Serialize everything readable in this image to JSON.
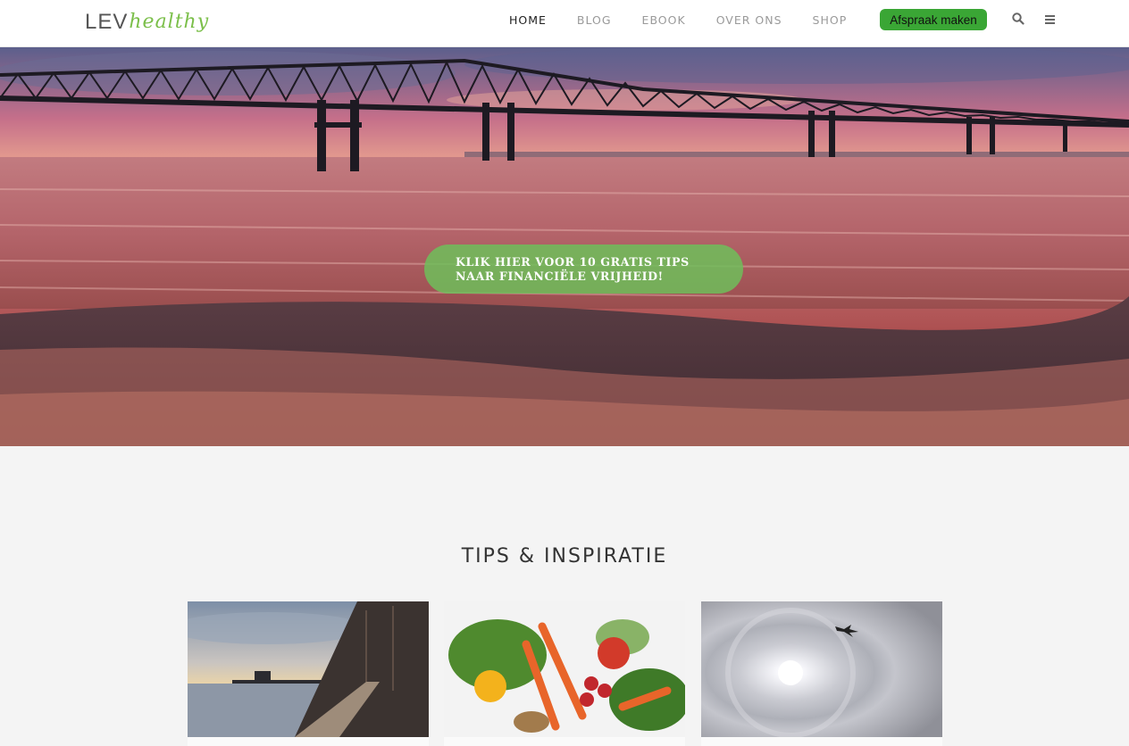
{
  "logo": {
    "part1": "LEV",
    "part2": "healthy"
  },
  "nav": {
    "items": [
      {
        "label": "HOME",
        "active": true
      },
      {
        "label": "BLOG",
        "active": false
      },
      {
        "label": "EBOOK",
        "active": false
      },
      {
        "label": "OVER ONS",
        "active": false
      },
      {
        "label": "SHOP",
        "active": false
      }
    ],
    "cta_label": "Afspraak maken",
    "search_icon": "search-icon",
    "menu_icon": "hamburger-menu-icon"
  },
  "hero": {
    "button_line1": "KLIK HIER VOOR 10 GRATIS TIPS",
    "button_line2": "NAAR FINANCIËLE VRIJHEID!",
    "image": "sunset-bridge-over-water"
  },
  "section": {
    "title": "TIPS & INSPIRATIE",
    "cards": [
      {
        "image": "sunset-pier-boardwalk"
      },
      {
        "image": "fresh-vegetables-carrots-strawberries"
      },
      {
        "image": "sun-halo-with-bird"
      }
    ]
  },
  "colors": {
    "accent_green": "#3aa635",
    "logo_green": "#7bbf4a",
    "nav_active": "#222222",
    "nav_inactive": "#9a9a9a"
  }
}
